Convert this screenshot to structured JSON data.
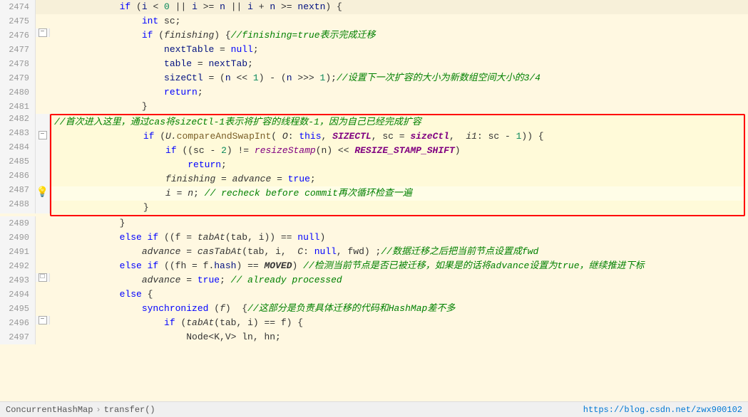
{
  "editor": {
    "background": "#fff8e1",
    "lines": [
      {
        "number": "2474",
        "indent": "            ",
        "hasFold": false,
        "hasGutter": false,
        "content": "if (<span class='param'>i</span> &lt; <span class='number'>0</span> || <span class='param'>i</span> &gt;= <span class='param'>n</span> || <span class='param'>i</span> + <span class='param'>n</span> &gt;= <span class='param'>nextn</span>) {"
      }
    ],
    "status": {
      "breadcrumb1": "ConcurrentHashMap",
      "breadcrumb2": "transfer()",
      "link": "https://blog.csdn.net/zwx900102"
    }
  }
}
